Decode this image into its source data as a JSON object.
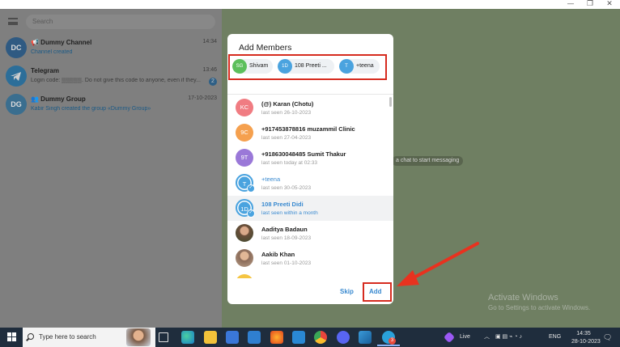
{
  "window": {
    "minimize": "—",
    "maximize": "❐",
    "close": "✕"
  },
  "sidebar": {
    "search_placeholder": "Search",
    "chats": [
      {
        "initials": "DC",
        "name": "📢 Dummy Channel",
        "preview": "Channel created",
        "time": "14:34",
        "color": "#2f5a82"
      },
      {
        "initials": "",
        "name": "Telegram",
        "preview": "Login code: ▒▒▒▒▒. Do not give this code to anyone, even if they...",
        "time": "13:46",
        "badge": "2",
        "color": "#2c6e99"
      },
      {
        "initials": "DG",
        "name": "👥 Dummy Group",
        "preview": "Kabir Singh created the group «Dummy Group»",
        "time": "17-10-2023",
        "color": "#3a6e8f"
      }
    ]
  },
  "main": {
    "hint": "a chat to start messaging"
  },
  "modal": {
    "title": "Add Members",
    "chips": [
      {
        "initials": "SG",
        "label": "Shivam",
        "color": "#5cbf5c"
      },
      {
        "initials": "1D",
        "label": "108 Preeti ...",
        "color": "#4aa3df"
      },
      {
        "initials": "T",
        "label": "+teena",
        "color": "#4aa3df"
      }
    ],
    "contacts": [
      {
        "initials": "KC",
        "name": "(@) Karan (Chotu)",
        "status": "last seen 26-10-2023",
        "color": "#f07c82",
        "selected": false
      },
      {
        "initials": "9C",
        "name": "+917453878816 muzammil Clinic",
        "status": "last seen 27-04-2023",
        "color": "#f5a04e",
        "selected": false
      },
      {
        "initials": "9T",
        "name": "+918630048485 Sumit Thakur",
        "status": "last seen today at 02:33",
        "color": "#9a78d8",
        "selected": false
      },
      {
        "initials": "T",
        "name": "+teena",
        "status": "last seen 30-05-2023",
        "color": "#4aa3df",
        "selected": true
      },
      {
        "initials": "1D",
        "name": "108 Preeti Didi",
        "status": "last seen within a month",
        "color": "#4aa3df",
        "selected": true
      },
      {
        "initials": "",
        "name": "Aaditya Badaun",
        "status": "last seen 18-09-2023",
        "color": "#6b4e3a",
        "selected": false
      },
      {
        "initials": "",
        "name": "Aakib Khan",
        "status": "last seen 01-10-2023",
        "color": "#8a6a58",
        "selected": false
      }
    ],
    "skip_label": "Skip",
    "add_label": "Add"
  },
  "watermark": {
    "line1": "Activate Windows",
    "line2": "Go to Settings to activate Windows."
  },
  "taskbar": {
    "search_placeholder": "Type here to search",
    "live_label": "Live",
    "language": "ENG",
    "time": "14:35",
    "date": "28-10-2023",
    "telegram_badge": "3"
  },
  "accent": "#3a8ad0",
  "highlight_color": "#d62b1f"
}
